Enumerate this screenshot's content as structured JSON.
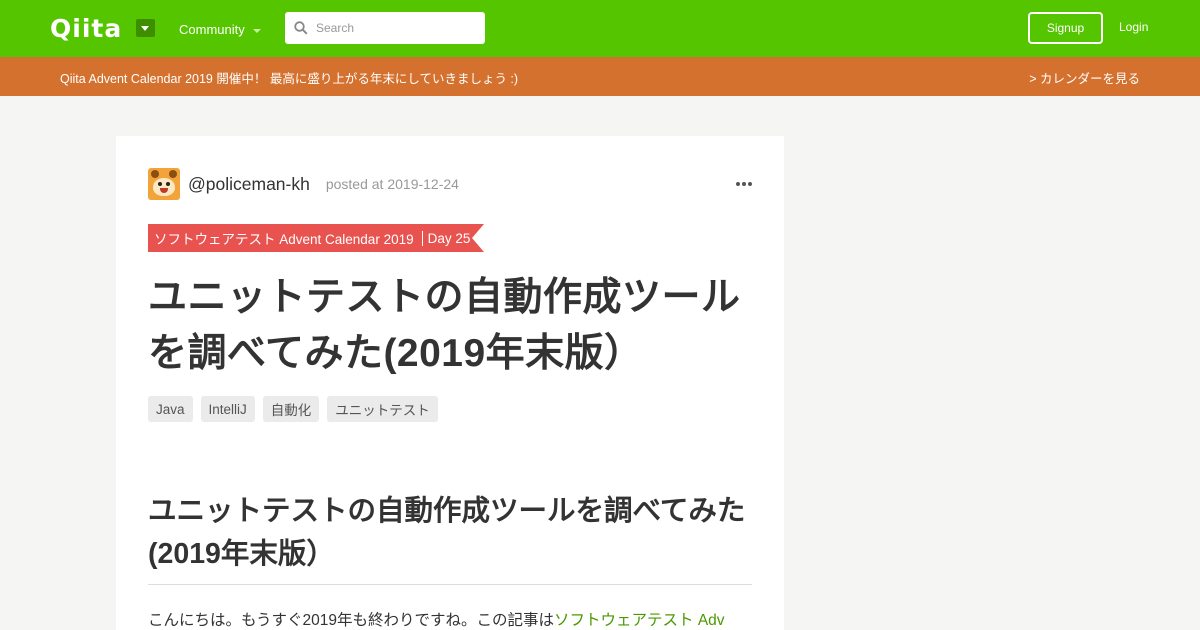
{
  "header": {
    "logo": "Qiita",
    "community_label": "Community",
    "search_placeholder": "Search",
    "signup_label": "Signup",
    "login_label": "Login"
  },
  "banner": {
    "text": "Qiita Advent Calendar 2019 開催中！ 最高に盛り上がる年末にしていきましょう :)",
    "link": "> カレンダーを見る"
  },
  "article": {
    "username": "@policeman-kh",
    "posted": "posted at 2019-12-24",
    "calendar_name": "ソフトウェアテスト Advent Calendar 2019",
    "calendar_day": "Day 25",
    "title": "ユニットテストの自動作成ツールを調べてみた(2019年末版）",
    "tags": [
      "Java",
      "IntelliJ",
      "自動化",
      "ユニットテスト"
    ],
    "heading": "ユニットテストの自動作成ツールを調べてみた(2019年末版）",
    "intro_text": "こんにちは。もうすぐ2019年も終わりですね。この記事は",
    "intro_link": "ソフトウェアテスト Adv"
  },
  "colors": {
    "header_green": "#55c500",
    "banner_orange": "#d4712f",
    "ribbon_red": "#e9534f",
    "link_green": "#4a9900"
  }
}
